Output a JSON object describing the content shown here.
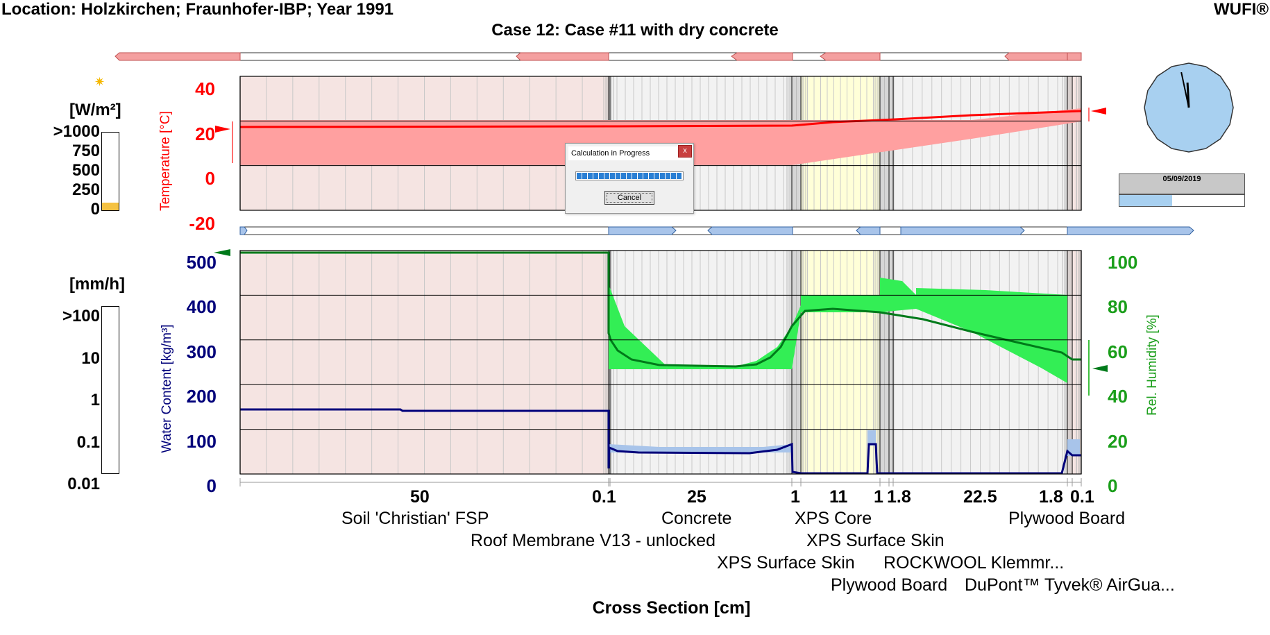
{
  "header": {
    "location": "Location: Holzkirchen; Fraunhofer-IBP; Year 1991",
    "brand": "WUFI®",
    "case_title": "Case 12: Case #11 with dry concrete"
  },
  "radiation_legend": {
    "unit": "[W/m²]",
    "ticks": [
      ">1000",
      "750",
      "500",
      "250",
      "0"
    ],
    "level_fraction": 0.1,
    "sun_icon": "sun-icon"
  },
  "rain_legend": {
    "unit": "[mm/h]",
    "ticks": [
      ">100",
      "10",
      "1",
      "0.1",
      "0.01"
    ]
  },
  "temperature_chart": {
    "ylabel": "Temperature [°C]",
    "ticks": [
      "40",
      "20",
      "0",
      "-20"
    ],
    "ylim": [
      -20,
      40
    ]
  },
  "moisture_chart": {
    "ylabel_left": "Water Content [kg/m³]",
    "ylabel_right": "Rel. Humidity [%]",
    "left_ticks": [
      "500",
      "400",
      "300",
      "200",
      "100",
      "0"
    ],
    "right_ticks": [
      "100",
      "80",
      "60",
      "40",
      "20",
      "0"
    ],
    "ylim_left": [
      0,
      500
    ],
    "ylim_right": [
      0,
      100
    ]
  },
  "cross_section": {
    "xlabel": "Cross Section [cm]",
    "thicknesses": [
      "50",
      "0.1",
      "25",
      "1",
      "11",
      "1",
      "1.8",
      "22.5",
      "1.8",
      "0.1"
    ],
    "materials": [
      "Soil 'Christian' FSP",
      "Roof Membrane V13 - unlocked",
      "Concrete",
      "XPS Surface Skin",
      "XPS Core",
      "XPS Surface Skin",
      "ROCKWOOL Klemmr...",
      "Plywood Board",
      "DuPont™ Tyvek® AirGua...",
      "Plywood Board"
    ]
  },
  "clock": {
    "date": "05/09/2019",
    "progress_fraction": 0.42,
    "hour": 11.9,
    "minute": 58
  },
  "dialog": {
    "title": "Calculation in Progress",
    "close_glyph": "x",
    "cancel_label": "Cancel",
    "progress_fraction": 1.0
  },
  "colors": {
    "temperature": "#ff0000",
    "temperature_band": "#ffa0a0",
    "water_content": "#00007a",
    "water_content_band": "#a8c4ea",
    "rel_humidity": "#008000",
    "rel_humidity_band": "#33ee55",
    "soil_fill": "#f5e4e2",
    "xps_core_fill": "#ffffd8",
    "other_fill": "#f2f2f2"
  }
}
